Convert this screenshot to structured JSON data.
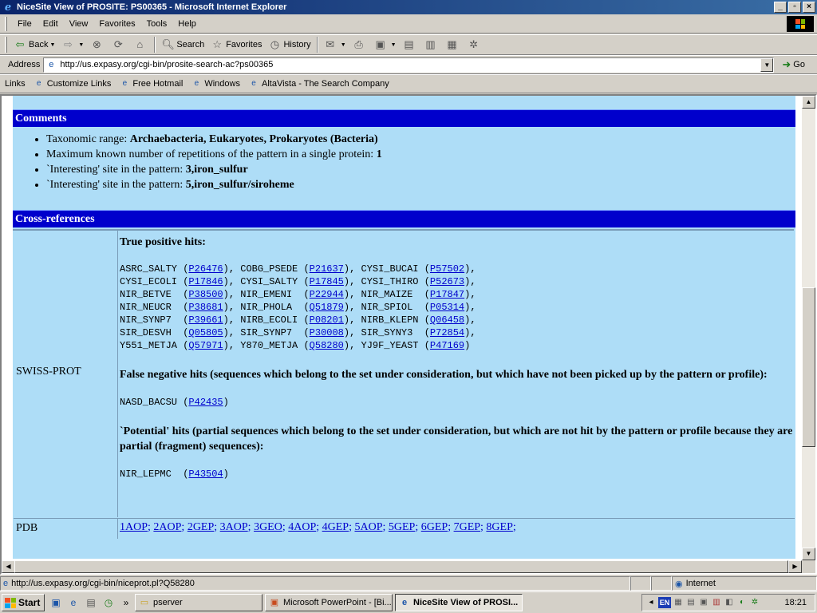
{
  "window": {
    "title": "NiceSite View of PROSITE: PS00365 - Microsoft Internet Explorer"
  },
  "menu": [
    "File",
    "Edit",
    "View",
    "Favorites",
    "Tools",
    "Help"
  ],
  "toolbar": {
    "back": "Back",
    "search": "Search",
    "favorites": "Favorites",
    "history": "History"
  },
  "address": {
    "label": "Address",
    "url": "http://us.expasy.org/cgi-bin/prosite-search-ac?ps00365",
    "go": "Go"
  },
  "links": {
    "label": "Links",
    "items": [
      "Customize Links",
      "Free Hotmail",
      "Windows",
      "AltaVista - The Search Company"
    ]
  },
  "comments": {
    "heading": "Comments",
    "items": [
      {
        "label": "Taxonomic range: ",
        "value": "Archaebacteria, Eukaryotes, Prokaryotes (Bacteria)"
      },
      {
        "label": "Maximum known number of repetitions of the pattern in a single protein: ",
        "value": "1"
      },
      {
        "label": "`Interesting' site in the pattern: ",
        "value": "3,iron_sulfur"
      },
      {
        "label": "`Interesting' site in the pattern: ",
        "value": "5,iron_sulfur/siroheme"
      }
    ]
  },
  "xref": {
    "heading": "Cross-references",
    "swissprot": {
      "label": "SWISS-PROT",
      "true_positive_heading": "True positive hits:",
      "true_positive_rows": [
        [
          [
            "ASRC_SALTY",
            "P26476"
          ],
          [
            "COBG_PSEDE",
            "P21637"
          ],
          [
            "CYSI_BUCAI",
            "P57502"
          ]
        ],
        [
          [
            "CYSI_ECOLI",
            "P17846"
          ],
          [
            "CYSI_SALTY",
            "P17845"
          ],
          [
            "CYSI_THIRO",
            "P52673"
          ]
        ],
        [
          [
            "NIR_BETVE",
            "P38500"
          ],
          [
            "NIR_EMENI",
            "P22944"
          ],
          [
            "NIR_MAIZE",
            "P17847"
          ]
        ],
        [
          [
            "NIR_NEUCR",
            "P38681"
          ],
          [
            "NIR_PHOLA",
            "Q51879"
          ],
          [
            "NIR_SPIOL",
            "P05314"
          ]
        ],
        [
          [
            "NIR_SYNP7",
            "P39661"
          ],
          [
            "NIRB_ECOLI",
            "P08201"
          ],
          [
            "NIRB_KLEPN",
            "Q06458"
          ]
        ],
        [
          [
            "SIR_DESVH",
            "Q05805"
          ],
          [
            "SIR_SYNP7",
            "P30008"
          ],
          [
            "SIR_SYNY3",
            "P72854"
          ]
        ],
        [
          [
            "Y551_METJA",
            "Q57971"
          ],
          [
            "Y870_METJA",
            "Q58280"
          ],
          [
            "YJ9F_YEAST",
            "P47169"
          ]
        ]
      ],
      "false_negative_heading": "False negative hits (sequences which belong to the set under consideration, but which have not been picked up by the pattern or profile):",
      "false_negative": [
        [
          "NASD_BACSU",
          "P42435"
        ]
      ],
      "potential_heading": "`Potential' hits (partial sequences which belong to the set under consideration, but which are not hit by the pattern or profile because they are partial (fragment) sequences):",
      "potential": [
        [
          "NIR_LEPMC",
          "P43504"
        ]
      ]
    },
    "pdb": {
      "label": "PDB",
      "entries": [
        "1AOP",
        "2AOP",
        "2GEP",
        "3AOP",
        "3GEO",
        "4AOP",
        "4GEP",
        "5AOP",
        "5GEP",
        "6GEP",
        "7GEP",
        "8GEP"
      ]
    }
  },
  "status": {
    "url": "http://us.expasy.org/cgi-bin/niceprot.pl?Q58280",
    "zone": "Internet"
  },
  "taskbar": {
    "start": "Start",
    "tasks": [
      "pserver",
      "Microsoft PowerPoint - [Bi...",
      "NiceSite View of PROSI..."
    ],
    "lang": "EN",
    "clock": "18:21"
  },
  "colors": {
    "page_bg": "#aeddf7",
    "band_bg": "#0000cc",
    "link": "#0000cc",
    "titlebar": "#0a246a"
  }
}
